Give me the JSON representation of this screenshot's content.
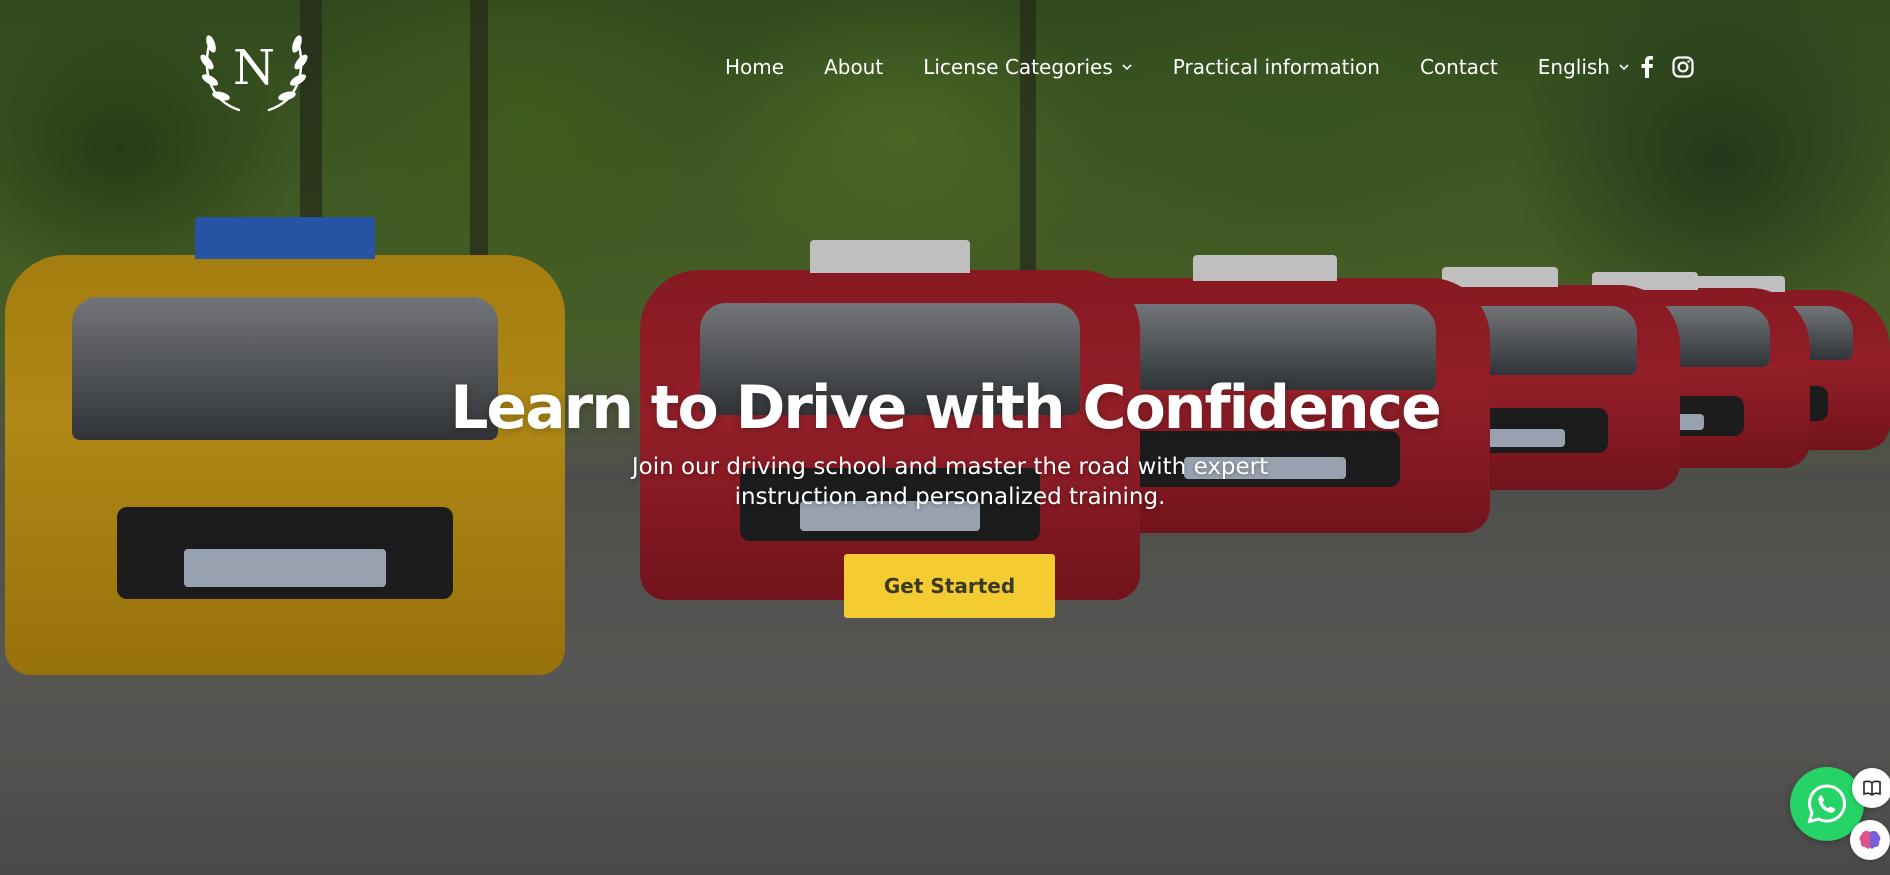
{
  "brand": {
    "logo_letter": "N"
  },
  "nav": {
    "items": [
      {
        "label": "Home",
        "has_dropdown": false
      },
      {
        "label": "About",
        "has_dropdown": false
      },
      {
        "label": "License Categories",
        "has_dropdown": true
      },
      {
        "label": "Practical information",
        "has_dropdown": false
      },
      {
        "label": "Contact",
        "has_dropdown": false
      },
      {
        "label": "English",
        "has_dropdown": true
      }
    ]
  },
  "social": {
    "icons": [
      "facebook-icon",
      "instagram-icon"
    ]
  },
  "hero": {
    "title": "Learn to Drive with Confidence",
    "subtitle": "Join our driving school and master the road with expert instruction and personalized training.",
    "cta_label": "Get Started"
  },
  "widgets": {
    "whatsapp_icon": "whatsapp-icon",
    "side_icons": [
      "book-icon",
      "brain-icon"
    ]
  },
  "colors": {
    "cta_bg": "#f5cb32",
    "whatsapp": "#25d366",
    "text": "#ffffff"
  }
}
